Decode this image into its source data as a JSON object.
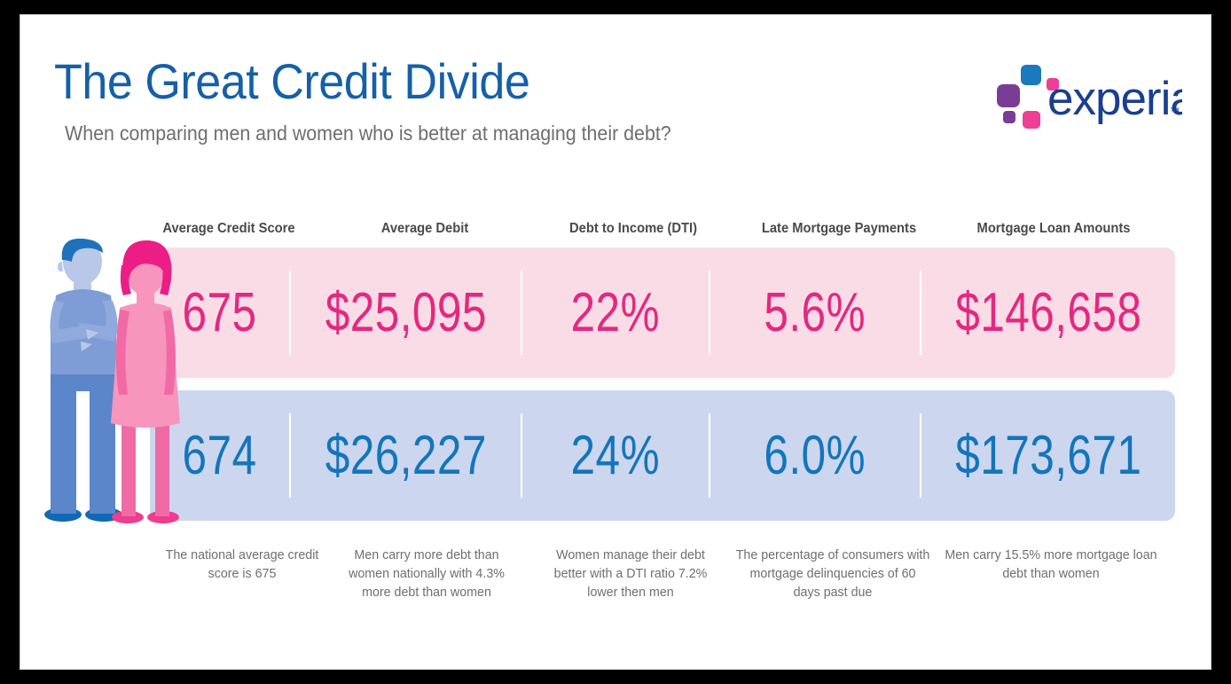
{
  "header": {
    "title": "The Great Credit Divide",
    "subtitle": "When comparing men and women who is better at managing their debt?",
    "logo_text": "experian",
    "logo_tm": "™"
  },
  "colors": {
    "title_blue": "#1560a8",
    "pink_value": "#e5287f",
    "blue_value": "#1475bb",
    "pink_row_bg": "#fadce7",
    "blue_row_bg": "#ccd7ef",
    "header_gray": "#4a4a4a",
    "caption_gray": "#6f6f6f",
    "logo_blue": "#1a7abf",
    "logo_purple": "#7a3d96",
    "logo_pink": "#ef3e96",
    "logo_word": "#1a3f8f"
  },
  "chart_data": {
    "type": "table",
    "title": "The Great Credit Divide",
    "subtitle": "When comparing men and women who is better at managing their debt?",
    "categories": [
      "Average Credit Score",
      "Average Debit",
      "Debt to Income (DTI)",
      "Late Mortgage Payments",
      "Mortgage Loan Amounts"
    ],
    "series": [
      {
        "name": "Women",
        "color": "#e5287f",
        "values": [
          "675",
          "$25,095",
          "22%",
          "5.6%",
          "$146,658"
        ]
      },
      {
        "name": "Men",
        "color": "#1475bb",
        "values": [
          "674",
          "$26,227",
          "24%",
          "6.0%",
          "$173,671"
        ]
      }
    ],
    "captions": [
      "The national average credit score is 675",
      "Men carry more debt than women nationally with 4.3% more debt than women",
      "Women manage their debt better with a DTI ratio 7.2% lower then men",
      "The percentage of consumers with mortgage delinquencies of 60 days past due",
      "Men carry 15.5% more mortgage loan debt than women"
    ],
    "legend_position": "row-left-illustration",
    "grid": false
  },
  "columns": [
    {
      "header": "Average Credit Score",
      "women": "675",
      "men": "674",
      "caption": "The national average credit score is 675"
    },
    {
      "header": "Average Debit",
      "women": "$25,095",
      "men": "$26,227",
      "caption": "Men carry more debt than women nationally with 4.3% more debt than women"
    },
    {
      "header": "Debt to Income (DTI)",
      "women": "22%",
      "men": "24%",
      "caption": "Women manage their debt better with a DTI ratio 7.2% lower then men"
    },
    {
      "header": "Late Mortgage Payments",
      "women": "5.6%",
      "men": "6.0%",
      "caption": "The percentage of consumers with mortgage delinquencies of 60 days past due"
    },
    {
      "header": "Mortgage Loan Amounts",
      "women": "$146,658",
      "men": "$173,671",
      "caption": "Men carry 15.5% more mortgage loan debt than women"
    }
  ]
}
